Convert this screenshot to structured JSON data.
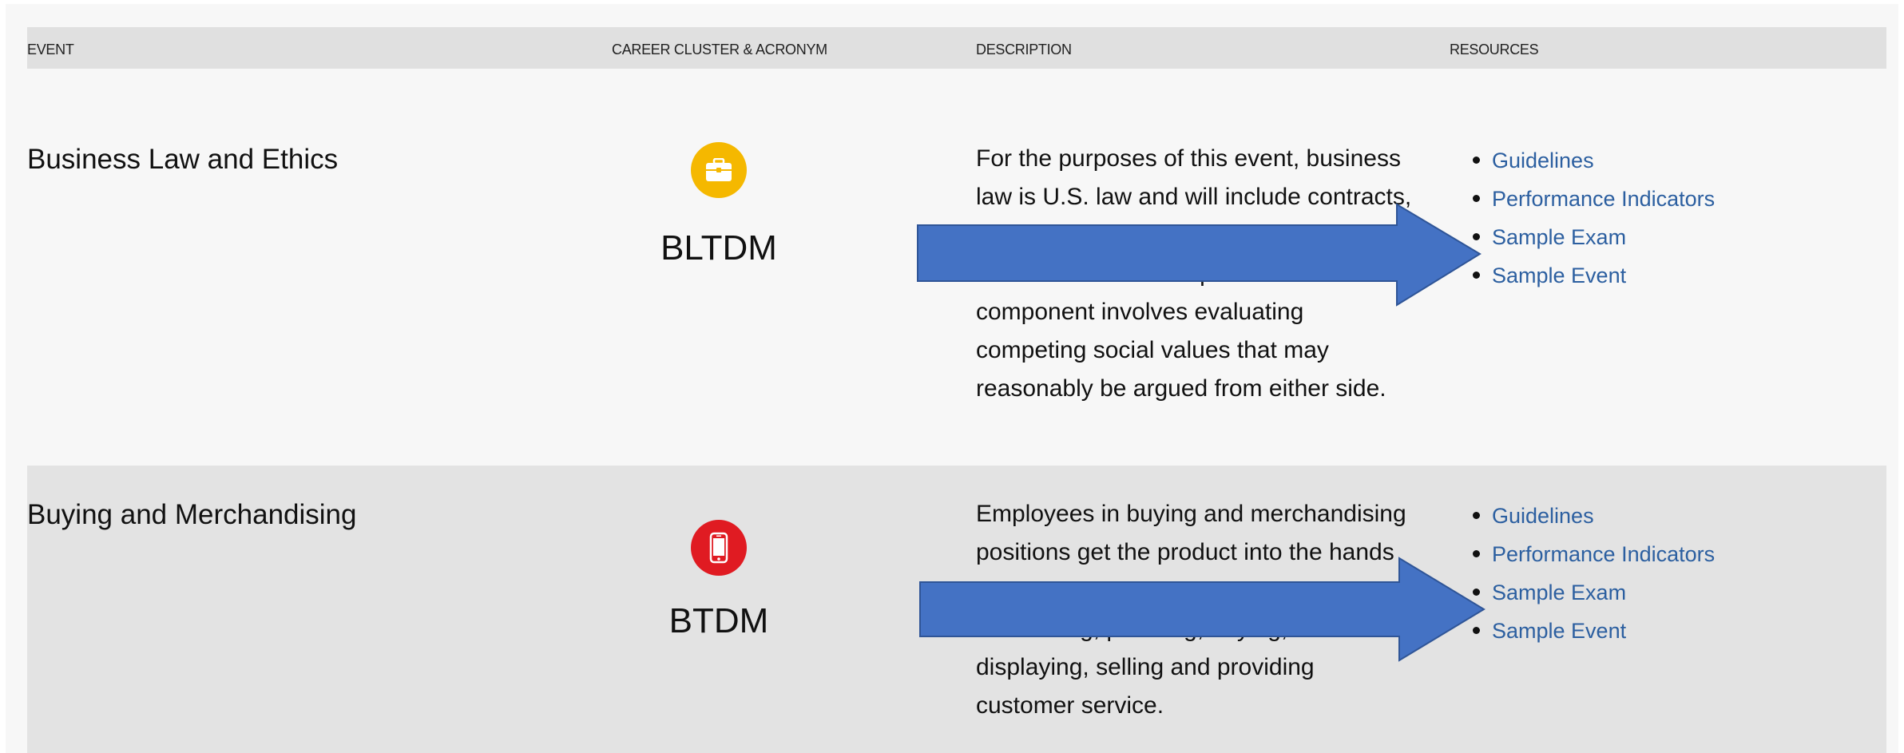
{
  "header": {
    "event": "EVENT",
    "cluster": "CAREER CLUSTER & ACRONYM",
    "description": "DESCRIPTION",
    "resources": "RESOURCES"
  },
  "events": [
    {
      "title": "Business Law and Ethics",
      "icon": "briefcase-icon",
      "icon_color": "#f5b800",
      "acronym": "BLTDM",
      "description": "For the purposes of this event, business law is U.S. law and will include contracts, ... ... ... of business ownership. The ethics component involves evaluating competing social values that may reasonably be argued from either side.",
      "resources": [
        "Guidelines",
        "Performance Indicators",
        "Sample Exam",
        "Sample Event"
      ]
    },
    {
      "title": "Buying and Merchandising",
      "icon": "mobile-phone-icon",
      "icon_color": "#e01b22",
      "acronym": "BTDM",
      "description": "Employees in buying and merchandising positions get the product into the hands of ... ... ... forecasting, planning, buying, displaying, selling and providing customer service.",
      "resources": [
        "Guidelines",
        "Performance Indicators",
        "Sample Exam",
        "Sample Event"
      ]
    }
  ],
  "colors": {
    "link": "#2c5fa0",
    "arrow": "#4472c4",
    "arrow_border": "#2f5597"
  }
}
